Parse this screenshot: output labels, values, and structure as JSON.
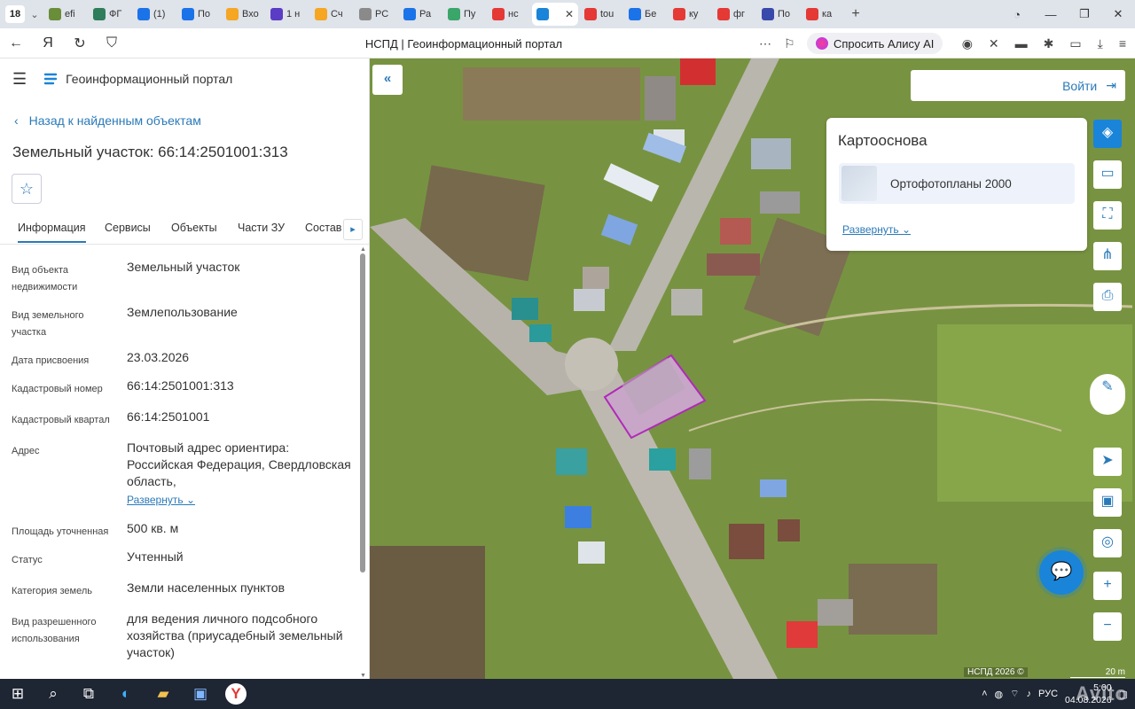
{
  "browser": {
    "tab_count": "18",
    "tabs": [
      {
        "label": "efi",
        "color": "#6a8d3a"
      },
      {
        "label": "ФГ",
        "color": "#2e7d5b"
      },
      {
        "label": "(1)",
        "color": "#1a73e8"
      },
      {
        "label": "По",
        "color": "#1a73e8"
      },
      {
        "label": "Вхо",
        "color": "#f5a623"
      },
      {
        "label": "1 н",
        "color": "#5b3cc4"
      },
      {
        "label": "Сч",
        "color": "#f5a623"
      },
      {
        "label": "РС",
        "color": "#8a8a8a"
      },
      {
        "label": "Ра",
        "color": "#1a73e8"
      },
      {
        "label": "Пу",
        "color": "#3aa66a"
      },
      {
        "label": "нс",
        "color": "#e53935"
      },
      {
        "label": "",
        "color": "#1a84d8",
        "active": true
      },
      {
        "label": "tou",
        "color": "#e53935"
      },
      {
        "label": "Бе",
        "color": "#1a73e8"
      },
      {
        "label": "ку",
        "color": "#e53935"
      },
      {
        "label": "фг",
        "color": "#e53935"
      },
      {
        "label": "По",
        "color": "#3949ab"
      },
      {
        "label": "ка",
        "color": "#e53935"
      }
    ],
    "window_title": "НСПД | Геоинформационный портал",
    "alice_label": "Спросить Алису AI"
  },
  "portal": {
    "title": "Геоинформационный портал",
    "back_label": "Назад к найденным объектам",
    "object_title": "Земельный участок: 66:14:2501001:313",
    "tabs": [
      "Информация",
      "Сервисы",
      "Объекты",
      "Части ЗУ",
      "Состав"
    ],
    "properties": [
      {
        "key": "Вид объекта недвижимости",
        "value": "Земельный участок"
      },
      {
        "key": "Вид земельного участка",
        "value": "Землепользование"
      },
      {
        "key": "Дата присвоения",
        "value": "23.03.2026"
      },
      {
        "key": "Кадастровый номер",
        "value": "66:14:2501001:313"
      },
      {
        "key": "Кадастровый квартал",
        "value": "66:14:2501001"
      },
      {
        "key": "Адрес",
        "value": "Почтовый адрес ориентира: Российская Федерация, Свердловская область,",
        "expand": "Развернуть"
      },
      {
        "key": "Площадь уточненная",
        "value": "500 кв. м"
      },
      {
        "key": "Статус",
        "value": "Учтенный"
      },
      {
        "key": "Категория земель",
        "value": "Земли населенных пунктов"
      },
      {
        "key": "Вид разрешенного использования",
        "value": "для ведения личного подсобного хозяйства (приусадебный земельный участок)"
      }
    ]
  },
  "map": {
    "login_label": "Войти",
    "basemap_title": "Картооснова",
    "basemap_item": "Ортофотопланы 2000",
    "basemap_expand": "Развернуть",
    "attribution": "НСПД 2026 ©",
    "scale_label": "20 m"
  },
  "taskbar": {
    "lang": "РУС",
    "time": "5:00",
    "date": "04.08.2026",
    "watermark": "Avito"
  }
}
